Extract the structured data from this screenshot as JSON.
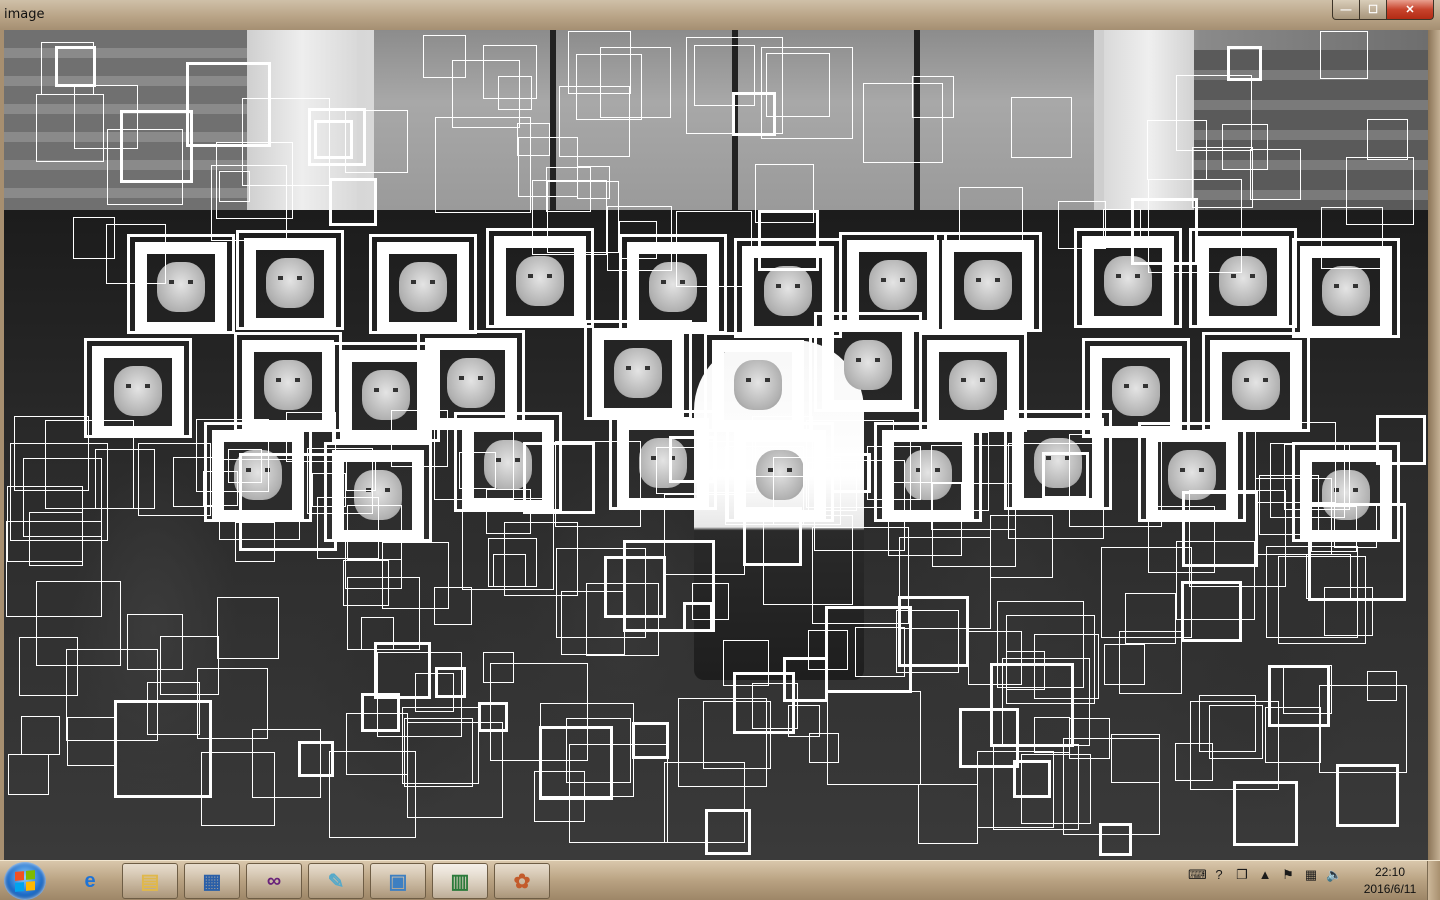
{
  "window": {
    "title": "image",
    "minimize_glyph": "—",
    "maximize_glyph": "☐",
    "close_glyph": "✕"
  },
  "canvas": {
    "content": "grayscale group photo of graduates with white face-detection rectangles overlaid"
  },
  "taskbar": {
    "start_icon": "windows-start-icon",
    "pinned": [
      {
        "name": "internet-explorer-icon",
        "glyph": "e",
        "color": "#1e73d6"
      },
      {
        "name": "file-explorer-icon",
        "glyph": "▤",
        "color": "#e0b84a"
      },
      {
        "name": "task-manager-icon",
        "glyph": "▦",
        "color": "#2a5fa8"
      },
      {
        "name": "visual-studio-icon",
        "glyph": "∞",
        "color": "#68217a"
      },
      {
        "name": "notepad-icon",
        "glyph": "✎",
        "color": "#56a9c9"
      },
      {
        "name": "photo-viewer-icon",
        "glyph": "▣",
        "color": "#3d7fc1"
      },
      {
        "name": "image-window-icon",
        "glyph": "▥",
        "color": "#2b7a3a"
      },
      {
        "name": "paint-icon",
        "glyph": "✿",
        "color": "#c35b2b"
      }
    ],
    "tray": [
      {
        "name": "keyboard-icon",
        "glyph": "⌨"
      },
      {
        "name": "help-icon",
        "glyph": "?"
      },
      {
        "name": "window-icon",
        "glyph": "❐"
      },
      {
        "name": "show-hidden-icons-icon",
        "glyph": "▲"
      },
      {
        "name": "flag-icon",
        "glyph": "⚑"
      },
      {
        "name": "network-icon",
        "glyph": "▦"
      },
      {
        "name": "volume-icon",
        "glyph": "🔈"
      }
    ],
    "clock": {
      "time": "22:10",
      "date": "2016/6/11"
    }
  }
}
